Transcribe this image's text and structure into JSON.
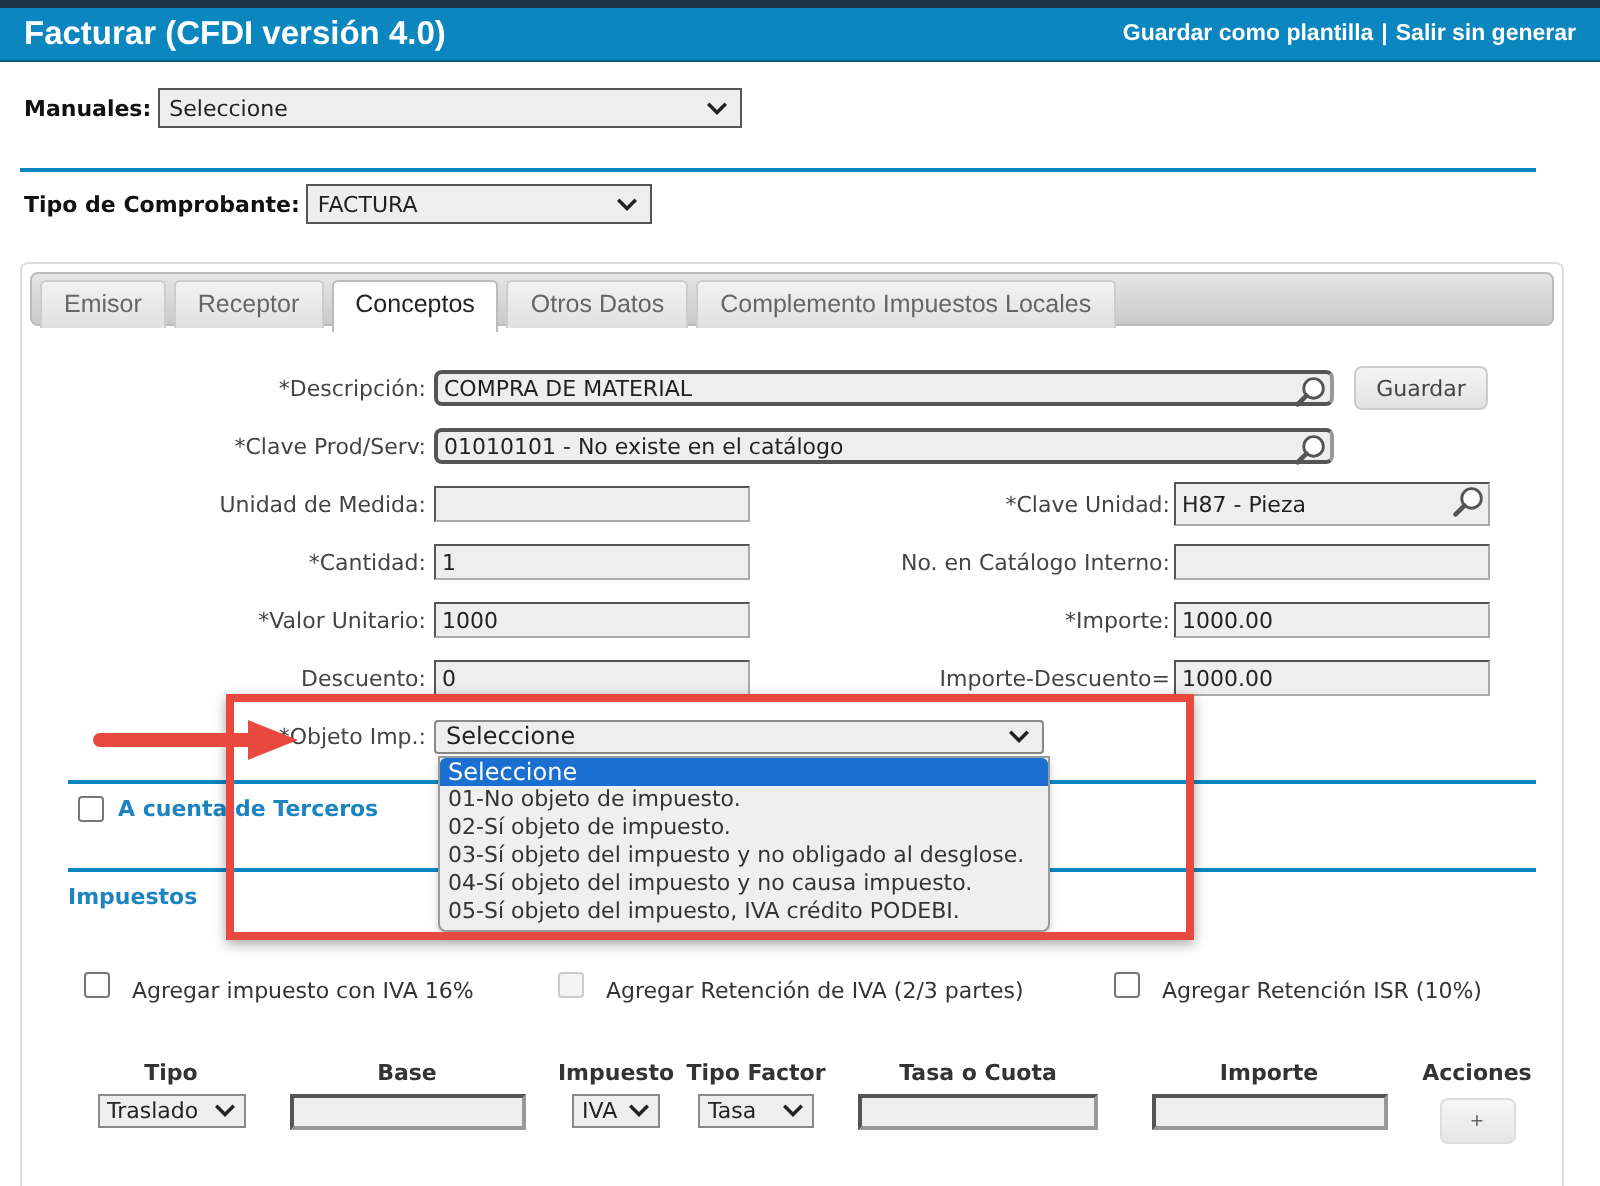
{
  "header": {
    "title": "Facturar (CFDI versión 4.0)",
    "links": [
      "Guardar como plantilla",
      "Salir sin generar"
    ],
    "separator": "|"
  },
  "manuales": {
    "label": "Manuales:",
    "value": "Seleccione"
  },
  "tipo_comprobante": {
    "label": "Tipo de Comprobante:",
    "value": "FACTURA"
  },
  "tabs": [
    {
      "label": "Emisor",
      "selected": false
    },
    {
      "label": "Receptor",
      "selected": false
    },
    {
      "label": "Conceptos",
      "selected": true
    },
    {
      "label": "Otros Datos",
      "selected": false
    },
    {
      "label": "Complemento Impuestos Locales",
      "selected": false
    }
  ],
  "form_rows": [
    [
      {
        "kind": "search_wide",
        "label": "*Descripción:",
        "value": "COMPRA DE MATERIAL"
      },
      {
        "kind": "button",
        "label": "Guardar"
      }
    ],
    [
      {
        "kind": "search_wide",
        "label": "*Clave Prod/Serv:",
        "value": "01010101 - No existe en el catálogo"
      }
    ],
    [
      {
        "kind": "text",
        "label": "Unidad de Medida:"
      },
      {
        "kind": "search",
        "label": "*Clave Unidad:",
        "value": "H87 - Pieza"
      }
    ],
    [
      {
        "kind": "text",
        "label": "*Cantidad:",
        "value": "1"
      },
      {
        "kind": "text",
        "label": "No. en Catálogo Interno:"
      }
    ],
    [
      {
        "kind": "text",
        "label": "*Valor Unitario:",
        "value": "1000"
      },
      {
        "kind": "text",
        "label": "*Importe:",
        "value": "1000.00"
      }
    ],
    [
      {
        "kind": "text",
        "label": "Descuento:",
        "value": "0"
      },
      {
        "kind": "text",
        "label": "Importe-Descuento=",
        "value": "1000.00"
      }
    ]
  ],
  "objeto_imp": {
    "label": "*Objeto Imp.:",
    "value": "Seleccione",
    "expanded": true,
    "options": [
      {
        "label": "Seleccione",
        "selected": true
      },
      {
        "label": "01-No objeto de impuesto.",
        "selected": false
      },
      {
        "label": "02-Sí objeto de impuesto.",
        "selected": false
      },
      {
        "label": "03-Sí objeto del impuesto y no obligado al desglose.",
        "selected": false
      },
      {
        "label": "04-Sí objeto del impuesto y no causa impuesto.",
        "selected": false
      },
      {
        "label": "05-Sí objeto del impuesto, IVA crédito PODEBI.",
        "selected": false
      }
    ]
  },
  "terceros": {
    "label": "A cuenta de Terceros",
    "checked": false
  },
  "impuestos_title": "Impuestos",
  "tax_checks": [
    {
      "label": "Agregar impuesto con  IVA 16%",
      "checked": false,
      "disabled": false
    },
    {
      "label": "Agregar Retención de IVA (2/3 partes)",
      "checked": false,
      "disabled": true
    },
    {
      "label": "Agregar Retención ISR (10%)",
      "checked": false,
      "disabled": false
    }
  ],
  "tax_table": {
    "columns": [
      "Tipo",
      "Base",
      "Impuesto",
      "Tipo Factor",
      "Tasa o Cuota",
      "Importe",
      "Acciones"
    ],
    "row": [
      {
        "kind": "select",
        "value": "Traslado"
      },
      {
        "kind": "input"
      },
      {
        "kind": "select",
        "value": "IVA"
      },
      {
        "kind": "select",
        "value": "Tasa"
      },
      {
        "kind": "input"
      },
      {
        "kind": "input"
      },
      {
        "kind": "button",
        "label": "+"
      }
    ]
  },
  "callout": {
    "shown": true
  }
}
